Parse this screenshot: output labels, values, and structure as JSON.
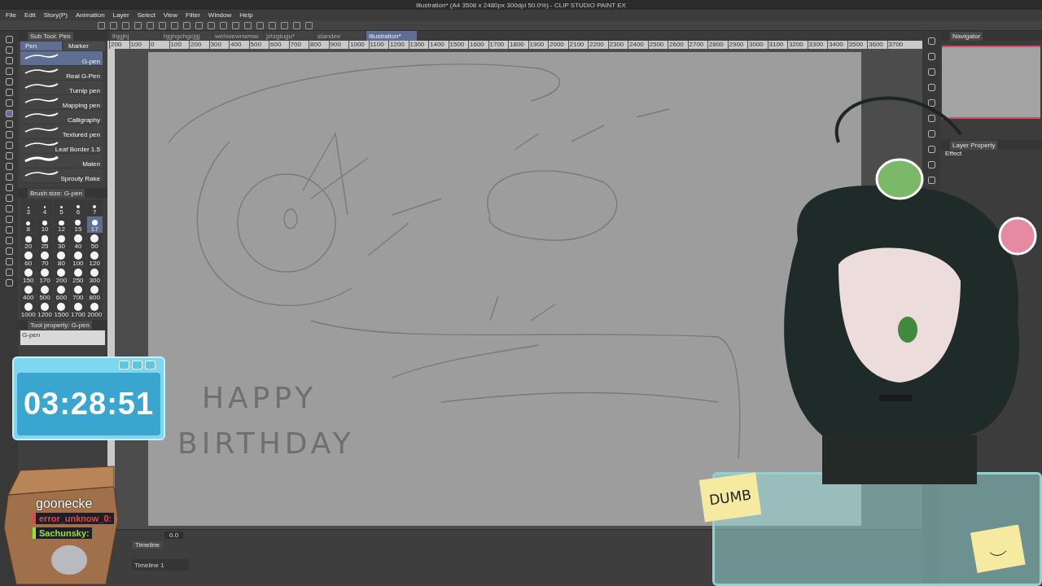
{
  "window": {
    "title": "Illustration* (A4 3508 x 2480px 300dpi 50.0%) - CLIP STUDIO PAINT EX"
  },
  "menu": [
    "File",
    "Edit",
    "Story(P)",
    "Animation",
    "Layer",
    "Select",
    "View",
    "Filter",
    "Window",
    "Help"
  ],
  "canvas_tabs": [
    {
      "label": "lhjgjhj",
      "selected": false
    },
    {
      "label": "hjghgchgcjgj",
      "selected": false
    },
    {
      "label": "wehwewnwmw",
      "selected": false
    },
    {
      "label": "jztzgtugu*",
      "selected": false
    },
    {
      "label": "standee",
      "selected": false
    },
    {
      "label": "Illustration*",
      "selected": true
    }
  ],
  "ruler": [
    "200",
    "100",
    "0",
    "100",
    "200",
    "300",
    "400",
    "500",
    "600",
    "700",
    "800",
    "900",
    "1000",
    "1100",
    "1200",
    "1300",
    "1400",
    "1500",
    "1600",
    "1700",
    "1800",
    "1900",
    "2000",
    "2100",
    "2200",
    "2300",
    "2400",
    "2500",
    "2600",
    "2700",
    "2800",
    "2900",
    "3000",
    "3100",
    "3200",
    "3300",
    "3400",
    "3500",
    "3600",
    "3700"
  ],
  "sub_tool": {
    "title": "Sub Tool: Pen",
    "groups": [
      {
        "label": "Pen",
        "selected": true
      },
      {
        "label": "Marker",
        "selected": false
      }
    ],
    "brushes": [
      {
        "name": "G-pen",
        "selected": true
      },
      {
        "name": "Real G-Pen",
        "selected": false
      },
      {
        "name": "Turnip pen",
        "selected": false
      },
      {
        "name": "Mapping pen",
        "selected": false
      },
      {
        "name": "Calligraphy",
        "selected": false
      },
      {
        "name": "Textured pen",
        "selected": false
      },
      {
        "name": "Leaf Border 1.5",
        "selected": false
      },
      {
        "name": "Malen",
        "selected": false
      },
      {
        "name": "Sprouty Rake",
        "selected": false
      }
    ]
  },
  "brush_size": {
    "title": "Brush size: G-pen",
    "sizes": [
      {
        "label": "3",
        "selected": false
      },
      {
        "label": "4",
        "selected": false
      },
      {
        "label": "5",
        "selected": false
      },
      {
        "label": "6",
        "selected": false
      },
      {
        "label": "7",
        "selected": false
      },
      {
        "label": "8",
        "selected": false
      },
      {
        "label": "10",
        "selected": false
      },
      {
        "label": "12",
        "selected": false
      },
      {
        "label": "15",
        "selected": false
      },
      {
        "label": "17",
        "selected": true
      },
      {
        "label": "20",
        "selected": false
      },
      {
        "label": "25",
        "selected": false
      },
      {
        "label": "30",
        "selected": false
      },
      {
        "label": "40",
        "selected": false
      },
      {
        "label": "50",
        "selected": false
      },
      {
        "label": "60",
        "selected": false
      },
      {
        "label": "70",
        "selected": false
      },
      {
        "label": "80",
        "selected": false
      },
      {
        "label": "100",
        "selected": false
      },
      {
        "label": "120",
        "selected": false
      },
      {
        "label": "150",
        "selected": false
      },
      {
        "label": "170",
        "selected": false
      },
      {
        "label": "200",
        "selected": false
      },
      {
        "label": "250",
        "selected": false
      },
      {
        "label": "300",
        "selected": false
      },
      {
        "label": "400",
        "selected": false
      },
      {
        "label": "500",
        "selected": false
      },
      {
        "label": "600",
        "selected": false
      },
      {
        "label": "700",
        "selected": false
      },
      {
        "label": "800",
        "selected": false
      },
      {
        "label": "1000",
        "selected": false
      },
      {
        "label": "1200",
        "selected": false
      },
      {
        "label": "1500",
        "selected": false
      },
      {
        "label": "1700",
        "selected": false
      },
      {
        "label": "2000",
        "selected": false
      }
    ]
  },
  "tool_property": {
    "title": "Tool property: G-pen",
    "tool": "G-pen"
  },
  "canvas": {
    "lettering": [
      "HAPPY",
      "BIRTHDAY"
    ]
  },
  "timer": {
    "time": "03:28:51"
  },
  "chat": {
    "title": "goonecke",
    "messages": [
      {
        "user": "error_unknow_0:",
        "color": "#e04848"
      },
      {
        "user": "Sachunsky:",
        "color": "#9be03c"
      }
    ]
  },
  "timeline": {
    "title": "Timeline",
    "track": "Timeline 1",
    "frame": "0.0"
  },
  "navigator": {
    "title": "Navigator"
  },
  "layer_property": {
    "title": "Layer Property",
    "effect": "Effect"
  },
  "sticky_note": "DUMB"
}
